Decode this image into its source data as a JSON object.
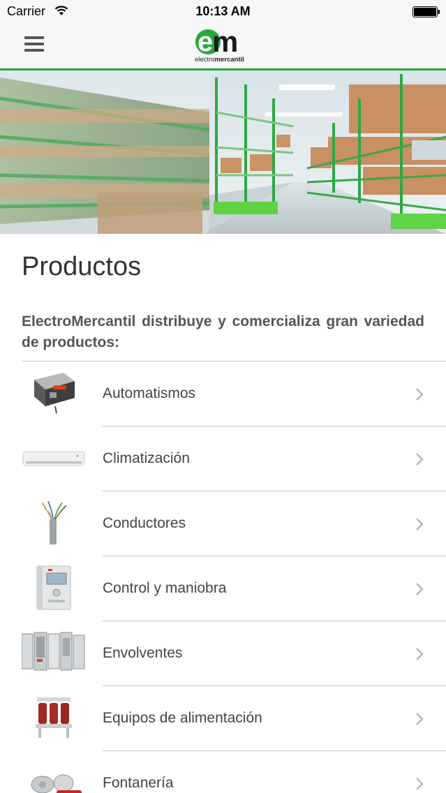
{
  "status_bar": {
    "carrier": "Carrier",
    "time": "10:13 AM"
  },
  "nav": {
    "logo_letters": "em",
    "logo_word_light": "electro",
    "logo_word_bold": "mercantil",
    "accent_color": "#27a83c"
  },
  "page": {
    "title": "Productos",
    "intro": "ElectroMercantil distribuye y comercializa gran variedad de productos:"
  },
  "products": [
    {
      "label": "Automatismos",
      "icon": "automation-device-icon"
    },
    {
      "label": "Climatización",
      "icon": "air-conditioner-icon"
    },
    {
      "label": "Conductores",
      "icon": "cable-icon"
    },
    {
      "label": "Control y maniobra",
      "icon": "drive-controller-icon"
    },
    {
      "label": "Envolventes",
      "icon": "enclosure-cabinets-icon"
    },
    {
      "label": "Equipos de alimentación",
      "icon": "transformer-icon"
    },
    {
      "label": "Fontanería",
      "icon": "valve-icon"
    }
  ]
}
